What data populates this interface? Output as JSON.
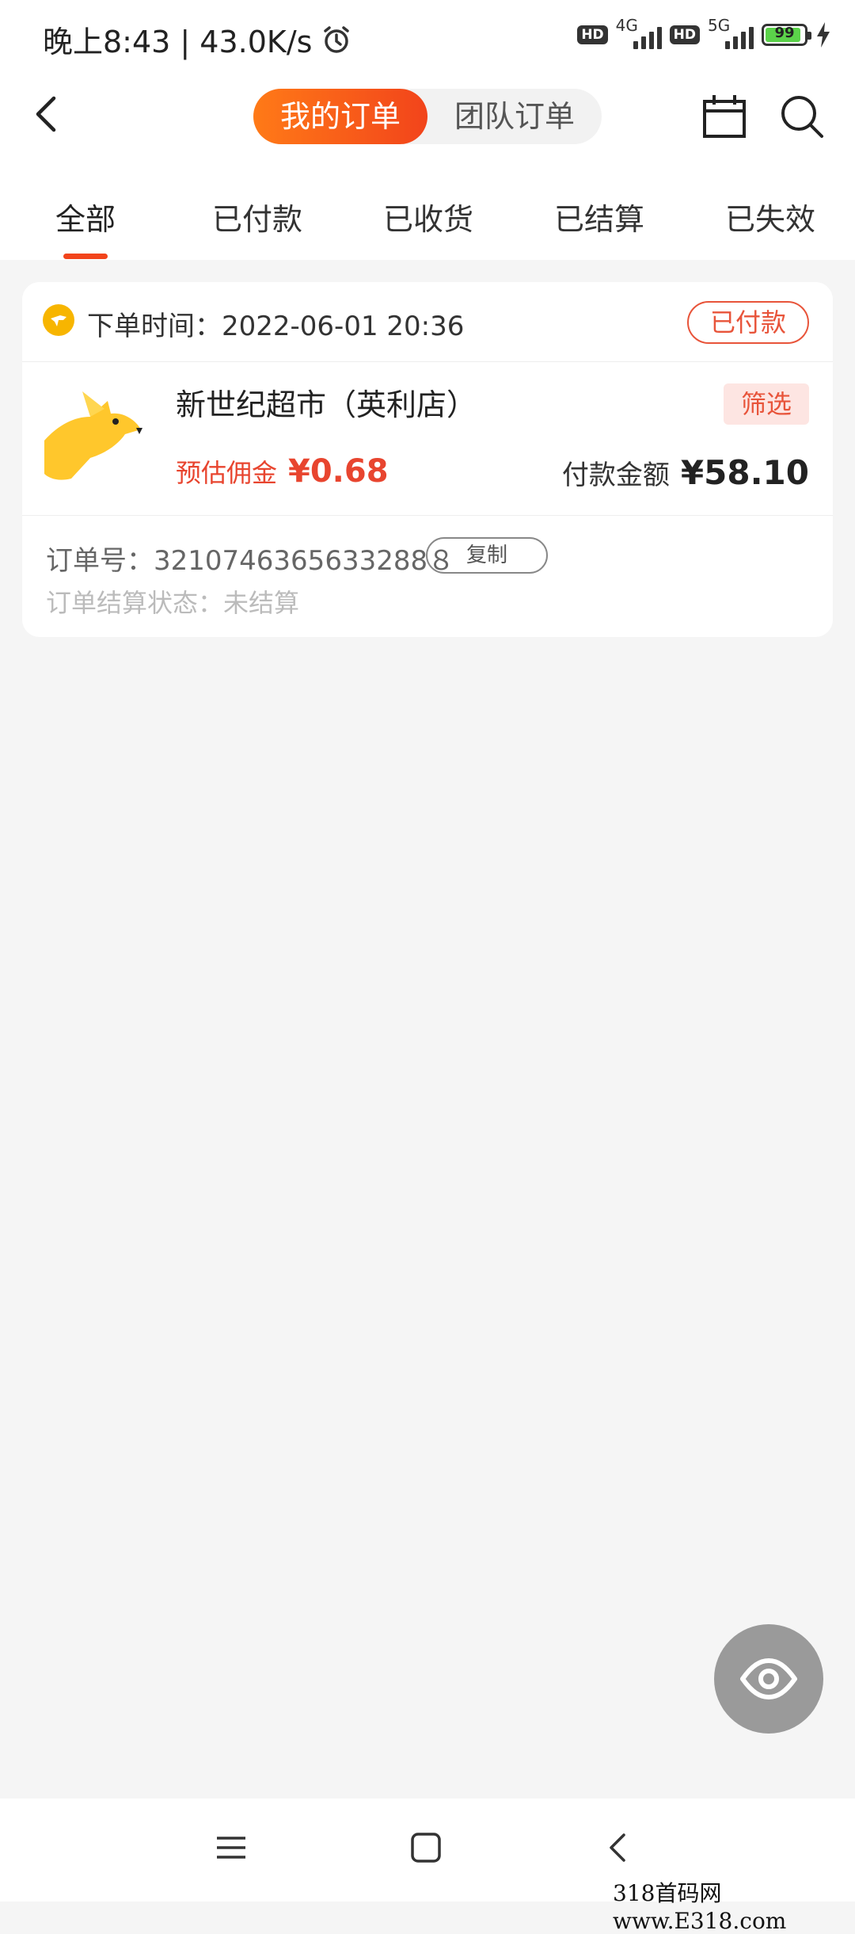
{
  "status_bar": {
    "left_text": "晚上8:43 | 43.0K/s",
    "hd1": "HD",
    "net1": "4G",
    "hd2": "HD",
    "net2": "5G",
    "battery": "99"
  },
  "header": {
    "tabs": [
      "我的订单",
      "团队订单"
    ],
    "active_index": 0
  },
  "filter_tabs": [
    {
      "label": "全部"
    },
    {
      "label": "已付款"
    },
    {
      "label": "已收货"
    },
    {
      "label": "已结算"
    },
    {
      "label": "已失效"
    }
  ],
  "order": {
    "time_label": "下单时间：2022-06-01 20:36",
    "status": "已付款",
    "shop_name": "新世纪超市（英利店）",
    "tag": "筛选",
    "commission_label": "预估佣金",
    "commission_amount": "¥0.68",
    "pay_label": "付款金额",
    "pay_amount": "¥58.10",
    "order_no": "订单号：3210746365633288８",
    "copy_label": "复制",
    "settle_status": "订单结算状态：未结算"
  },
  "watermark": "318首码网 www.E318.com",
  "colors": {
    "accent": "#f2441b",
    "badge": "#e8543a",
    "logo_yellow": "#f7b500"
  }
}
